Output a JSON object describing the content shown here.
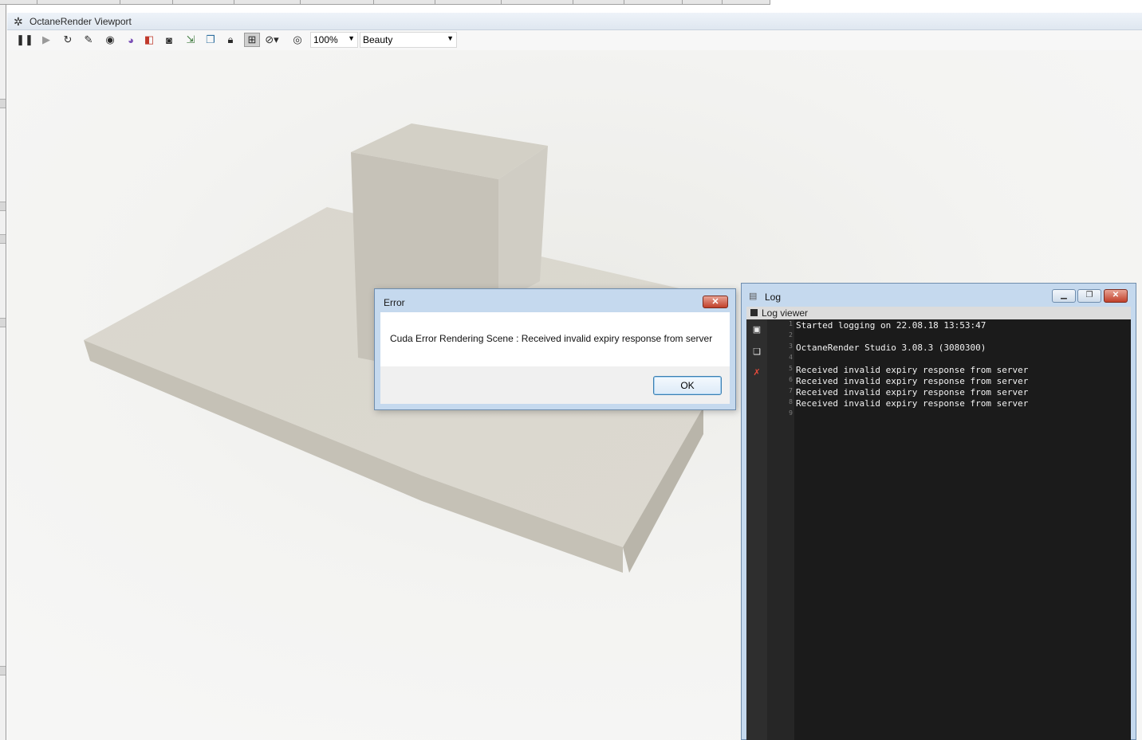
{
  "viewport": {
    "title": "OctaneRender Viewport",
    "zoom": "100%",
    "render_pass": "Beauty"
  },
  "error_dialog": {
    "title": "Error",
    "close_glyph": "✕",
    "message": "Cuda Error Rendering Scene : Received invalid expiry response from server",
    "ok_label": "OK"
  },
  "log_window": {
    "title": "Log",
    "header": "Log viewer",
    "lines": [
      {
        "num": "1",
        "text": "Started logging on 22.08.18 13:53:47"
      },
      {
        "num": "2",
        "text": ""
      },
      {
        "num": "3",
        "text": "OctaneRender Studio 3.08.3 (3080300)"
      },
      {
        "num": "4",
        "text": ""
      },
      {
        "num": "5",
        "text": "Received invalid expiry response from server"
      },
      {
        "num": "6",
        "text": "Received invalid expiry response from server"
      },
      {
        "num": "7",
        "text": "Received invalid expiry response from server"
      },
      {
        "num": "8",
        "text": "Received invalid expiry response from server"
      },
      {
        "num": "9",
        "text": ""
      }
    ]
  },
  "colors": {
    "dialog_frame": "#c5d9ee",
    "log_background": "#1b1b1b",
    "close_button": "#c1402a",
    "scene_object": "#d8d5cc"
  },
  "icons": {
    "title_icon": "octane-gear-icon",
    "pause": "pause-icon",
    "play": "play-icon",
    "restart": "restart-icon",
    "lock": "lock-icon"
  }
}
